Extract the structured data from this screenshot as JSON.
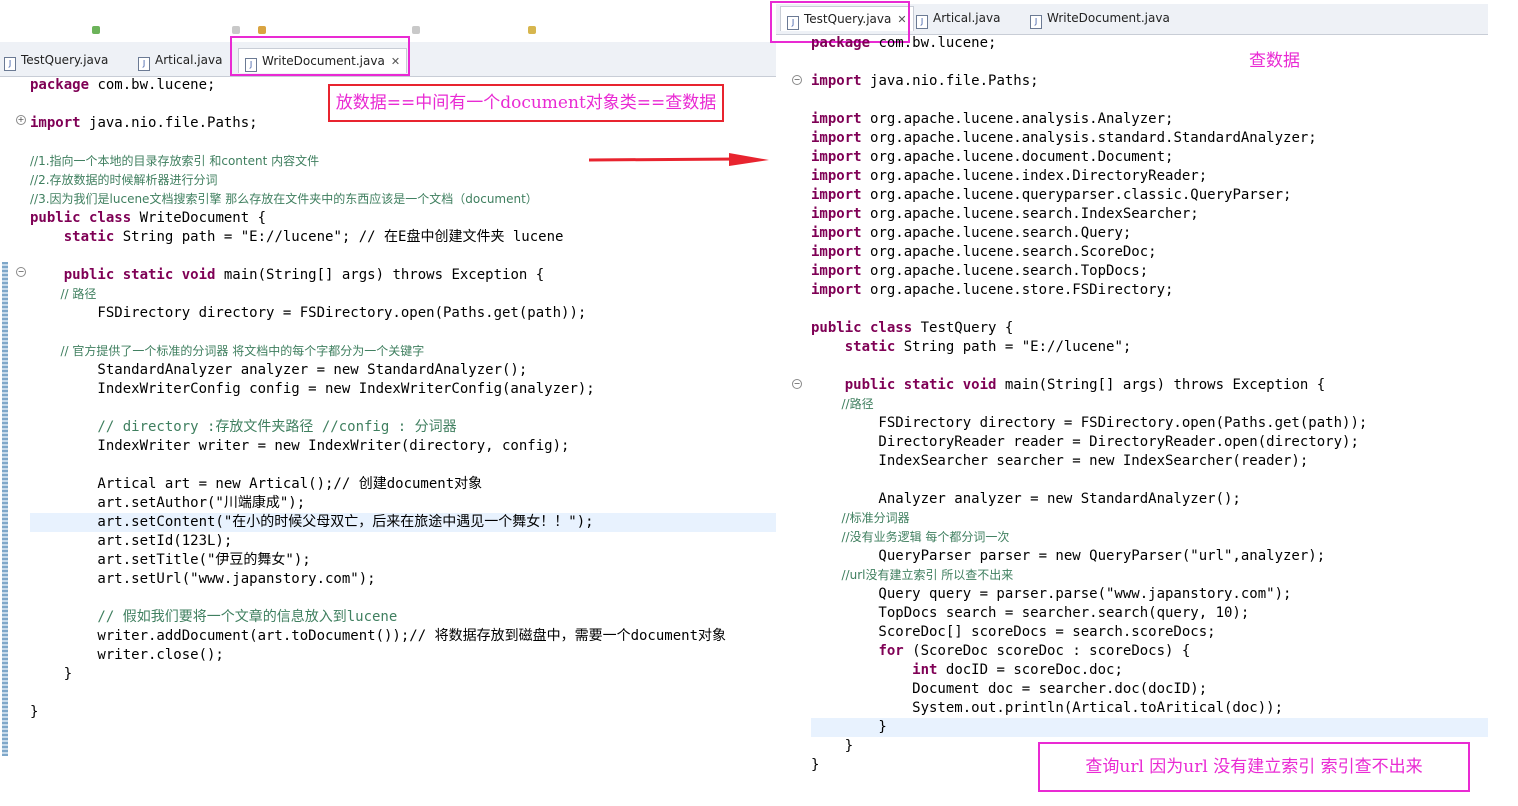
{
  "left": {
    "tabs": [
      {
        "label": "TestQuery.java",
        "active": false
      },
      {
        "label": "Artical.java",
        "active": false
      },
      {
        "label": "WriteDocument.java",
        "active": true
      }
    ],
    "annotation": "放数据==中间有一个document对象类==查数据",
    "lines": [
      "package com.bw.lucene;",
      "",
      "import java.nio.file.Paths;",
      "",
      "//1.指向一个本地的目录存放索引 和content 内容文件",
      "//2.存放数据的时候解析器进行分词",
      "//3.因为我们是lucene文档搜索引擎 那么存放在文件夹中的东西应该是一个文档（document）",
      "public class WriteDocument {",
      "    static String path = \"E://lucene\"; // 在E盘中创建文件夹 lucene",
      "",
      "    public static void main(String[] args) throws Exception {",
      "        // 路径",
      "        FSDirectory directory = FSDirectory.open(Paths.get(path));",
      "",
      "        // 官方提供了一个标准的分词器 将文档中的每个字都分为一个关键字",
      "        StandardAnalyzer analyzer = new StandardAnalyzer();",
      "        IndexWriterConfig config = new IndexWriterConfig(analyzer);",
      "",
      "        // directory :存放文件夹路径 //config : 分词器",
      "        IndexWriter writer = new IndexWriter(directory, config);",
      "",
      "        Artical art = new Artical();// 创建document对象",
      "        art.setAuthor(\"川端康成\");",
      "        art.setContent(\"在小的时候父母双亡，后来在旅途中遇见一个舞女！！\");",
      "        art.setId(123L);",
      "        art.setTitle(\"伊豆的舞女\");",
      "        art.setUrl(\"www.japanstory.com\");",
      "",
      "        // 假如我们要将一个文章的信息放入到lucene",
      "        writer.addDocument(art.toDocument());// 将数据存放到磁盘中，需要一个document对象",
      "        writer.close();",
      "    }",
      "",
      "}"
    ]
  },
  "right": {
    "tabs": [
      {
        "label": "TestQuery.java",
        "active": true
      },
      {
        "label": "Artical.java",
        "active": false
      },
      {
        "label": "WriteDocument.java",
        "active": false
      }
    ],
    "annotation_title": "查数据",
    "annotation_note": "查询url  因为url 没有建立索引   索引查不出来",
    "lines": [
      "package com.bw.lucene;",
      "",
      "import java.nio.file.Paths;",
      "",
      "import org.apache.lucene.analysis.Analyzer;",
      "import org.apache.lucene.analysis.standard.StandardAnalyzer;",
      "import org.apache.lucene.document.Document;",
      "import org.apache.lucene.index.DirectoryReader;",
      "import org.apache.lucene.queryparser.classic.QueryParser;",
      "import org.apache.lucene.search.IndexSearcher;",
      "import org.apache.lucene.search.Query;",
      "import org.apache.lucene.search.ScoreDoc;",
      "import org.apache.lucene.search.TopDocs;",
      "import org.apache.lucene.store.FSDirectory;",
      "",
      "public class TestQuery {",
      "    static String path = \"E://lucene\";",
      "",
      "    public static void main(String[] args) throws Exception {",
      "        //路径",
      "        FSDirectory directory = FSDirectory.open(Paths.get(path));",
      "        DirectoryReader reader = DirectoryReader.open(directory);",
      "        IndexSearcher searcher = new IndexSearcher(reader);",
      "",
      "        Analyzer analyzer = new StandardAnalyzer();",
      "        //标准分词器",
      "        //没有业务逻辑 每个都分词一次",
      "        QueryParser parser = new QueryParser(\"url\",analyzer);",
      "        //url没有建立索引 所以查不出来",
      "        Query query = parser.parse(\"www.japanstory.com\");",
      "        TopDocs search = searcher.search(query, 10);",
      "        ScoreDoc[] scoreDocs = search.scoreDocs;",
      "        for (ScoreDoc scoreDoc : scoreDocs) {",
      "            int docID = scoreDoc.doc;",
      "            Document doc = searcher.doc(docID);",
      "            System.out.println(Artical.toAritical(doc));",
      "        }",
      "    }",
      "}"
    ]
  },
  "colors": {
    "keyword": "#7f0055",
    "string": "#2a00ff",
    "comment": "#3f7f5f",
    "field": "#0000c0",
    "local_var": "#6a3e3e",
    "annotation": "#e92ad3",
    "arrow": "#e8242f",
    "highlight": "#e8f2fe"
  }
}
